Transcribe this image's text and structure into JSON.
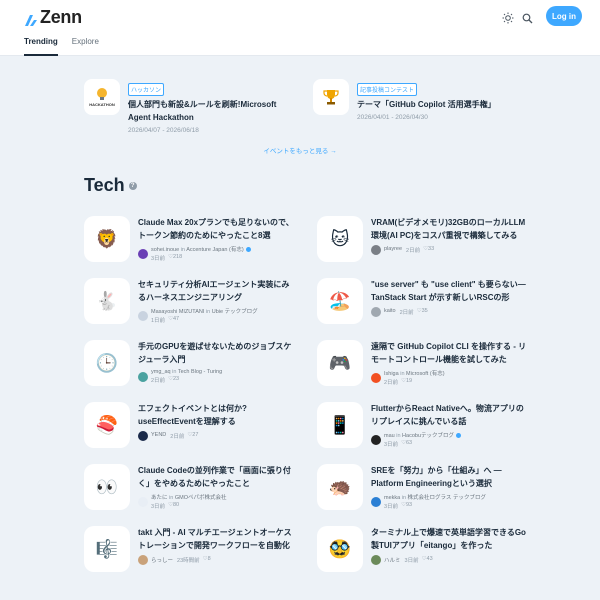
{
  "header": {
    "logo_text": "Zenn",
    "login_label": "Log in",
    "tabs": [
      {
        "label": "Trending",
        "active": true
      },
      {
        "label": "Explore",
        "active": false
      }
    ]
  },
  "events": [
    {
      "tag": "ハッカソン",
      "thumb_label": "HACKATHON",
      "title": "個人部門も新設&ルールを刷新!Microsoft Agent Hackathon",
      "date": "2026/04/07 - 2026/06/18"
    },
    {
      "tag": "記事投稿コンテスト",
      "thumb_label": "",
      "title": "テーマ「GitHub Copilot 活用選手権」",
      "date": "2026/04/01 - 2026/04/30"
    }
  ],
  "more_events_label": "イベントをもっと見る →",
  "section_title": "Tech",
  "articles": [
    {
      "emoji": "🦁",
      "title": "Claude Max 20xプランでも足りないので、トークン節約のためにやったこと8選",
      "author": "sohei.inoue",
      "in": "in",
      "publication": "Accenture Japan (有志)",
      "verified": true,
      "time": "3日前",
      "likes": "218",
      "avatar_color": "#6a3fb5"
    },
    {
      "emoji": "🐱",
      "title": "VRAM(ビデオメモリ)32GBのローカルLLM環境(AI PC)をコスパ重視で構築してみる",
      "author": "playree",
      "in": "",
      "publication": "",
      "verified": false,
      "time": "2日前",
      "likes": "33",
      "avatar_color": "#7a7f86"
    },
    {
      "emoji": "🐇",
      "title": "セキュリティ分析AIエージェント実装にみるハーネスエンジニアリング",
      "author": "Masayoshi MIZUTANI",
      "in": "in",
      "publication": "Ubie テックブログ",
      "verified": false,
      "time": "1日前",
      "likes": "47",
      "avatar_color": "#c9d3e0"
    },
    {
      "emoji": "🏖️",
      "title": "\"use server\" も \"use client\" も要らない—TanStack Start が示す新しいRSCの形",
      "author": "kaito",
      "in": "",
      "publication": "",
      "verified": false,
      "time": "2日前",
      "likes": "35",
      "avatar_color": "#a0a8b0"
    },
    {
      "emoji": "🕒",
      "title": "手元のGPUを遊ばせないためのジョブスケジューラ入門",
      "author": "ymg_aq",
      "in": "in",
      "publication": "Tech Blog - Turing",
      "verified": false,
      "time": "2日前",
      "likes": "23",
      "avatar_color": "#4aa2a0"
    },
    {
      "emoji": "🎮",
      "title": "遠隔で GitHub Copilot CLI を操作する - リモートコントロール機能を試してみた",
      "author": "Ishiga",
      "in": "in",
      "publication": "Microsoft (有志)",
      "verified": false,
      "time": "2日前",
      "likes": "19",
      "avatar_color": "#f25022"
    },
    {
      "emoji": "🍣",
      "title": "エフェクトイベントとは何か?useEffectEventを理解する",
      "author": "YEND",
      "in": "",
      "publication": "",
      "verified": false,
      "time": "2日前",
      "likes": "27",
      "avatar_color": "#1a2a4a"
    },
    {
      "emoji": "📱",
      "title": "FlutterからReact Nativeへ。物流アプリのリプレイスに挑んでいる話",
      "author": "mau",
      "in": "in",
      "publication": "Hacobuテックブログ",
      "verified": true,
      "time": "3日前",
      "likes": "63",
      "avatar_color": "#222222"
    },
    {
      "emoji": "👀",
      "title": "Claude Codeの並列作業で「画面に張り付く」をやめるためにやったこと",
      "author": "あたに",
      "in": "in",
      "publication": "GMOペパボ株式会社",
      "verified": false,
      "time": "3日前",
      "likes": "80",
      "avatar_color": "#e8eef5"
    },
    {
      "emoji": "🦔",
      "title": "SREを「努力」から「仕組み」へ — Platform Engineeringという選択",
      "author": "mekka",
      "in": "in",
      "publication": "株式会社ログラス テックブログ",
      "verified": false,
      "time": "3日前",
      "likes": "93",
      "avatar_color": "#2a7fd4"
    },
    {
      "emoji": "🎼",
      "title": "takt 入門 - AI マルチエージェントオーケストレーションで開発ワークフローを自動化する",
      "author": "らっしー",
      "in": "",
      "publication": "",
      "verified": false,
      "time": "23時間前",
      "likes": "8",
      "avatar_color": "#c9a27a"
    },
    {
      "emoji": "🥸",
      "title": "ターミナル上で爆速で英単語学習できるGo製TUIアプリ「eitango」を作った",
      "author": "ハルミ",
      "in": "",
      "publication": "",
      "verified": false,
      "time": "3日前",
      "likes": "43",
      "avatar_color": "#6b8a5a"
    }
  ]
}
